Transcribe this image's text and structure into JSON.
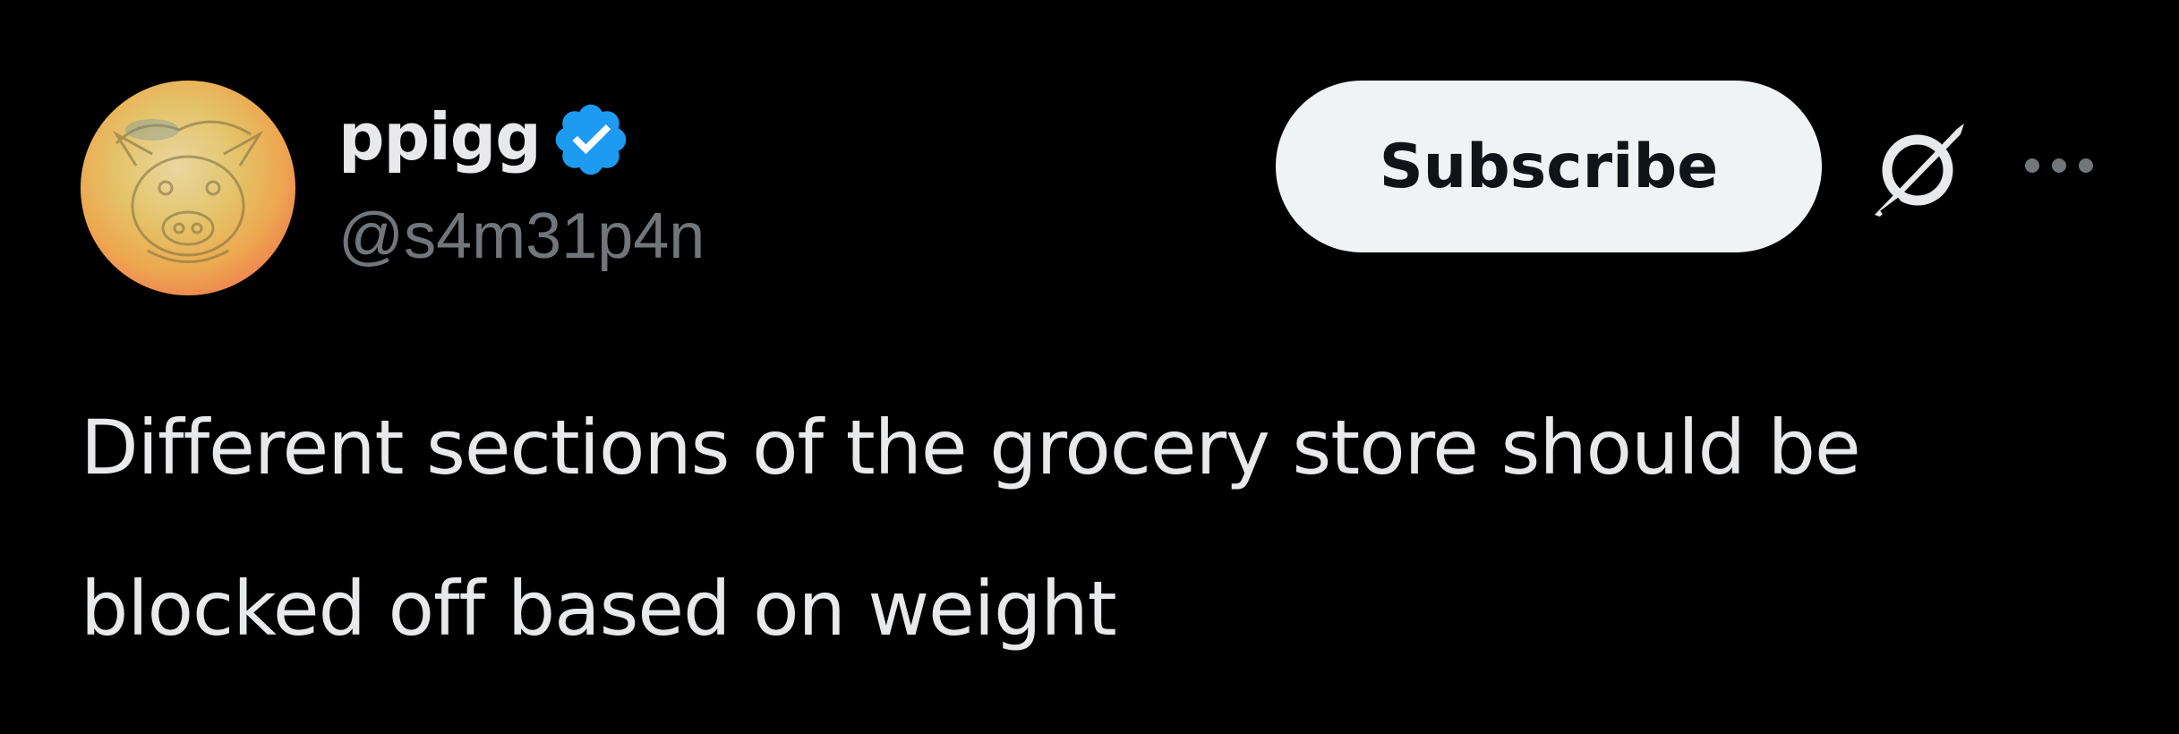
{
  "author": {
    "display_name": "ppigg",
    "handle": "@s4m31p4n",
    "verified": true,
    "avatar_icon": "pig-avatar-icon"
  },
  "actions": {
    "subscribe_label": "Subscribe",
    "grok_icon": "grok-icon",
    "more_icon": "more-icon"
  },
  "tweet": {
    "lines": [
      "Different sections of the grocery store should be",
      "blocked off based on weight"
    ]
  },
  "colors": {
    "background": "#000000",
    "text_primary": "#e7e9ea",
    "text_secondary": "#71767b",
    "verified_badge": "#1d9bf0",
    "subscribe_bg": "#eff3f4",
    "subscribe_text": "#0f1419"
  }
}
